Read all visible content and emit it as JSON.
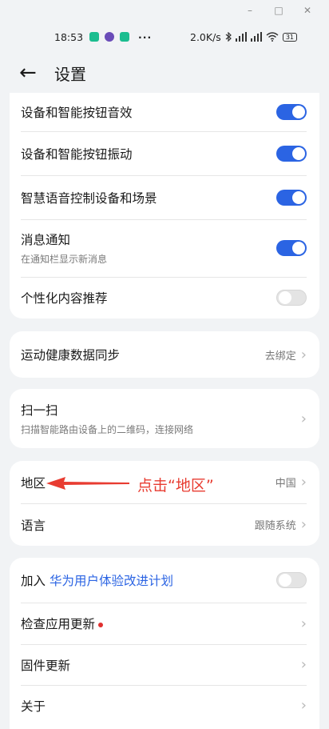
{
  "window": {
    "minimize": "–",
    "maximize": "□",
    "close": "✕"
  },
  "status_bar": {
    "time": "18:53",
    "more": "···",
    "speed": "2.0K/s",
    "battery": "31",
    "icons": [
      "bluetooth-icon",
      "signal-icon",
      "wifi-icon"
    ],
    "colors": {
      "app1": "#1bbd8f",
      "app2": "#6a4cb8",
      "app3": "#1bbd8f"
    }
  },
  "header": {
    "back": "←",
    "title": "设置"
  },
  "card1": {
    "rows": [
      {
        "label": "设备和智能按钮音效",
        "on": true
      },
      {
        "label": "设备和智能按钮振动",
        "on": true
      },
      {
        "label": "智慧语音控制设备和场景",
        "on": true
      },
      {
        "label": "消息通知",
        "sub": "在通知栏显示新消息",
        "on": true
      },
      {
        "label": "个性化内容推荐",
        "on": false
      }
    ]
  },
  "card2": {
    "label": "运动健康数据同步",
    "value": "去绑定"
  },
  "card3": {
    "label": "扫一扫",
    "sub": "扫描智能路由设备上的二维码，连接网络"
  },
  "card4": {
    "region": {
      "label": "地区",
      "value": "中国"
    },
    "language": {
      "label": "语言",
      "value": "跟随系统"
    }
  },
  "card5": {
    "join_prefix": "加入",
    "join_link": "华为用户体验改进计划",
    "join_on": false,
    "check_update": "检查应用更新",
    "firmware": "固件更新",
    "about": "关于"
  },
  "chevron": "›",
  "annotation": {
    "text": "点击“地区”",
    "color": "#e83c31"
  },
  "colors": {
    "accent": "#2b64e3",
    "background": "#f1f3f5"
  }
}
